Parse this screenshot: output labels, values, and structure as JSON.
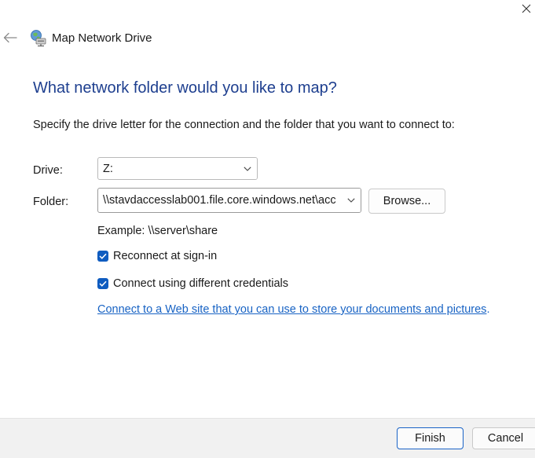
{
  "window": {
    "title": "Map Network Drive"
  },
  "icons": {
    "close": "close-icon",
    "back": "back-arrow-icon",
    "title": "network-drive-icon",
    "dropdown": "chevron-down-icon",
    "checkbox": "checkmark-icon"
  },
  "main": {
    "heading": "What network folder would you like to map?",
    "instruction": "Specify the drive letter for the connection and the folder that you want to connect to:",
    "drive_label": "Drive:",
    "drive_value": "Z:",
    "folder_label": "Folder:",
    "folder_value": "\\\\stavdaccesslab001.file.core.windows.net\\acc",
    "browse_label": "Browse...",
    "example_text": "Example: \\\\server\\share",
    "reconnect_label": "Reconnect at sign-in",
    "reconnect_checked": true,
    "credentials_label": "Connect using different credentials",
    "credentials_checked": true,
    "web_link_text": "Connect to a Web site that you can use to store your documents and pictures",
    "web_link_period": "."
  },
  "footer": {
    "finish_label": "Finish",
    "cancel_label": "Cancel"
  },
  "colors": {
    "heading": "#1e3f8f",
    "accent": "#0f5cc0",
    "link": "#1863c4",
    "footer_bg": "#f1f1f1"
  }
}
